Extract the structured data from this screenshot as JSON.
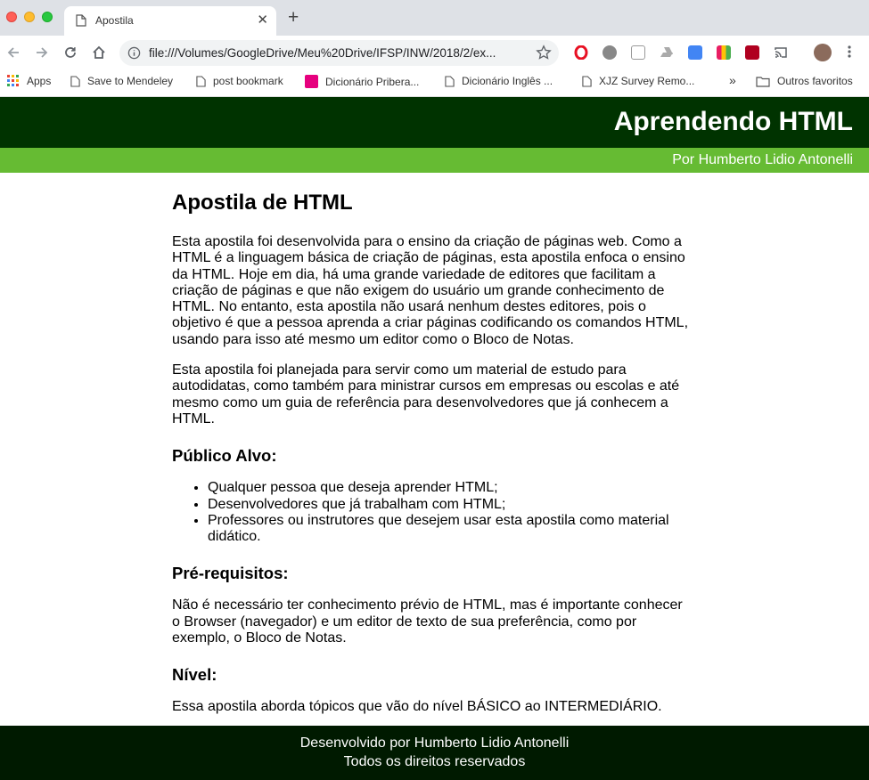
{
  "browser": {
    "tab_title": "Apostila",
    "url": "file:///Volumes/GoogleDrive/Meu%20Drive/IFSP/INW/2018/2/ex...",
    "bookmarks": [
      "Apps",
      "Save to Mendeley",
      "post bookmark",
      "Dicionário Pribera...",
      "Dicionário Inglês ...",
      "XJZ Survey Remo..."
    ],
    "overflow_label": "»",
    "other_bookmarks": "Outros favoritos"
  },
  "header": {
    "title": "Aprendendo HTML",
    "byline": "Por Humberto Lidio Antonelli"
  },
  "content": {
    "heading": "Apostila de HTML",
    "paragraph1": "Esta apostila foi desenvolvida para o ensino da criação de páginas web. Como a HTML é a linguagem básica de criação de páginas, esta apostila enfoca o ensino da HTML. Hoje em dia, há uma grande variedade de editores que facilitam a criação de páginas e que não exigem do usuário um grande conhecimento de HTML. No entanto, esta apostila não usará nenhum destes editores, pois o objetivo é que a pessoa aprenda a criar páginas codificando os comandos HTML, usando para isso até mesmo um editor como o Bloco de Notas.",
    "paragraph2": "Esta apostila foi planejada para servir como um material de estudo para autodidatas, como também para ministrar cursos em empresas ou escolas e até mesmo como um guia de referência para desenvolvedores que já conhecem a HTML.",
    "audience_heading": "Público Alvo:",
    "audience": [
      "Qualquer pessoa que deseja aprender HTML;",
      "Desenvolvedores que já trabalham com HTML;",
      "Professores ou instrutores que desejem usar esta apostila como material didático."
    ],
    "prereq_heading": "Pré-requisitos:",
    "prereq_text": "Não é necessário ter conhecimento prévio de HTML, mas é importante conhecer o Browser (navegador) e um editor de texto de sua preferência, como por exemplo, o Bloco de Notas.",
    "level_heading": "Nível:",
    "level_text": "Essa apostila aborda tópicos que vão do nível BÁSICO ao INTERMEDIÁRIO."
  },
  "footer": {
    "line1": "Desenvolvido por Humberto Lidio Antonelli",
    "line2": "Todos os direitos reservados"
  },
  "colors": {
    "header_bg": "#003300",
    "byline_bg": "#66bb33",
    "footer_bg": "#001a00"
  }
}
